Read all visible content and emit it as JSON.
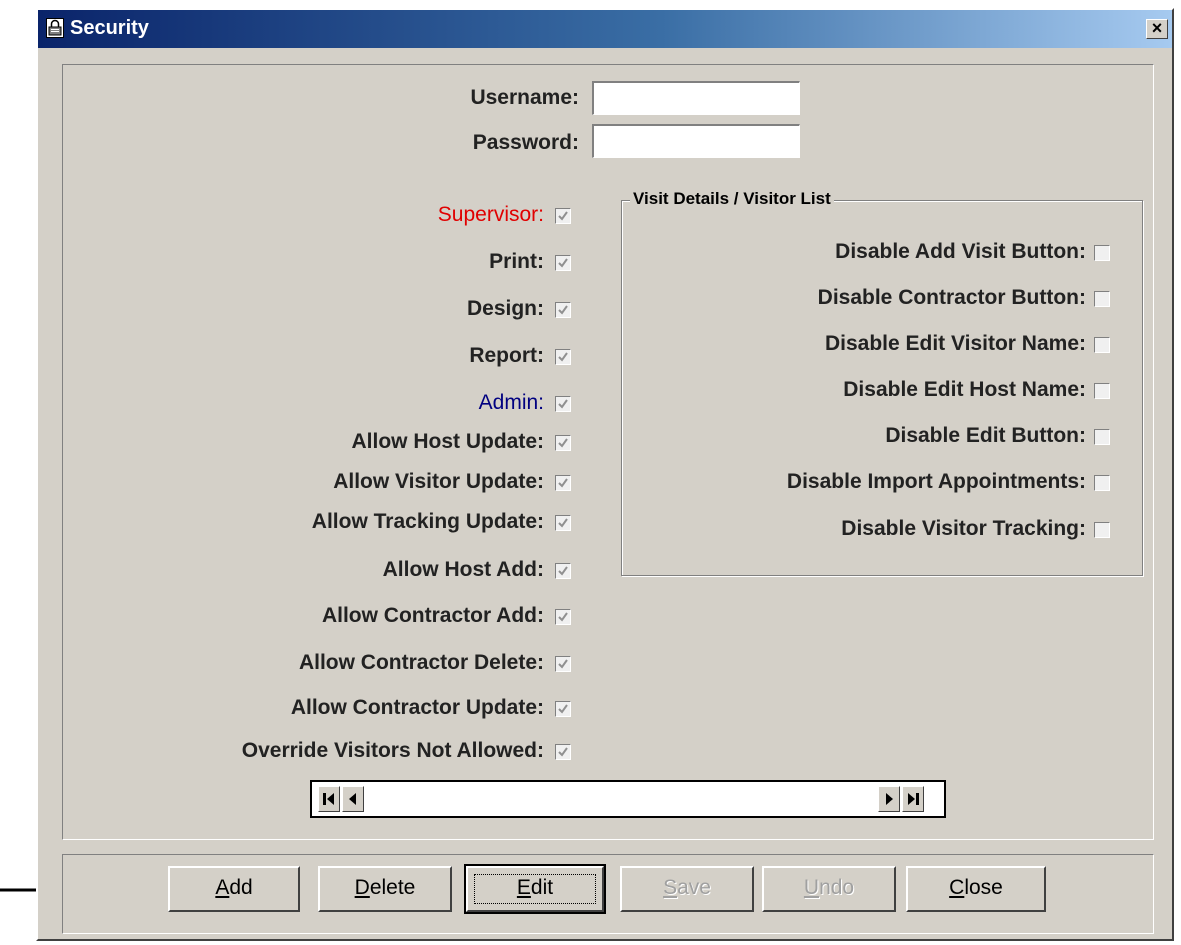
{
  "window": {
    "title": "Security",
    "title_icon": "lock-icon",
    "close_label": "×"
  },
  "credentials": {
    "username_label": "Username:",
    "username_value": "",
    "password_label": "Password:",
    "password_value": ""
  },
  "permissions": [
    {
      "label": "Supervisor:",
      "checked": true,
      "color": "#e00000"
    },
    {
      "label": "Print:",
      "checked": true
    },
    {
      "label": "Design:",
      "checked": true
    },
    {
      "label": "Report:",
      "checked": true
    },
    {
      "label": "Admin:",
      "checked": true,
      "color": "#000080"
    },
    {
      "label": "Allow Host Update:",
      "checked": true
    },
    {
      "label": "Allow Visitor Update:",
      "checked": true
    },
    {
      "label": "Allow Tracking Update:",
      "checked": true
    },
    {
      "label": "Allow Host Add:",
      "checked": true
    },
    {
      "label": "Allow Contractor Add:",
      "checked": true
    },
    {
      "label": "Allow Contractor Delete:",
      "checked": true
    },
    {
      "label": "Allow Contractor Update:",
      "checked": true
    },
    {
      "label": "Override Visitors Not Allowed:",
      "checked": true
    }
  ],
  "visit_group": {
    "title": "Visit Details / Visitor List",
    "items": [
      {
        "label": "Disable Add Visit Button:",
        "checked": false
      },
      {
        "label": "Disable Contractor Button:",
        "checked": false
      },
      {
        "label": "Disable Edit Visitor Name:",
        "checked": false
      },
      {
        "label": "Disable Edit Host Name:",
        "checked": false
      },
      {
        "label": "Disable Edit Button:",
        "checked": false
      },
      {
        "label": "Disable Import Appointments:",
        "checked": false
      },
      {
        "label": "Disable Visitor Tracking:",
        "checked": false
      }
    ]
  },
  "navigator": {
    "first_icon": "first-record-icon",
    "prev_icon": "previous-record-icon",
    "next_icon": "next-record-icon",
    "last_icon": "last-record-icon"
  },
  "buttons": {
    "add": {
      "label": "Add",
      "accel": "A",
      "rest": "dd",
      "enabled": true
    },
    "delete": {
      "label": "Delete",
      "accel": "D",
      "rest": "elete",
      "enabled": true
    },
    "edit": {
      "label": "Edit",
      "accel": "E",
      "rest": "dit",
      "enabled": true,
      "focused": true
    },
    "save": {
      "label": "Save",
      "accel": "S",
      "rest": "ave",
      "enabled": false
    },
    "undo": {
      "label": "Undo",
      "accel": "U",
      "rest": "ndo",
      "enabled": false
    },
    "close": {
      "label": "Close",
      "accel": "C",
      "rest": "lose",
      "enabled": true
    }
  },
  "colors": {
    "dialog_bg": "#d4d0c8",
    "title_start": "#0a246a",
    "title_end": "#a6caf0"
  }
}
